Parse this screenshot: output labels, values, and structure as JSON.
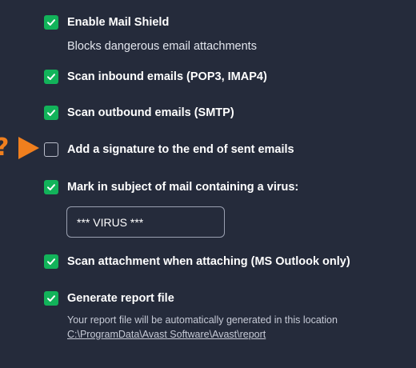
{
  "settings": {
    "enable_mail_shield": {
      "label": "Enable Mail Shield",
      "checked": true,
      "description": "Blocks dangerous email attachments"
    },
    "scan_inbound": {
      "label": "Scan inbound emails (POP3, IMAP4)",
      "checked": true
    },
    "scan_outbound": {
      "label": "Scan outbound emails (SMTP)",
      "checked": true
    },
    "add_signature": {
      "label": "Add a signature to the end of sent emails",
      "checked": false
    },
    "mark_subject": {
      "label": "Mark in subject of mail containing a virus:",
      "checked": true,
      "input_value": "*** VIRUS ***"
    },
    "scan_attachment": {
      "label": "Scan attachment when attaching (MS Outlook only)",
      "checked": true
    },
    "generate_report": {
      "label": "Generate report file",
      "checked": true,
      "description": "Your report file will be automatically generated in this location",
      "path": "C:\\ProgramData\\Avast Software\\Avast\\report"
    }
  },
  "annotation": {
    "glyph": "?",
    "color": "#f07f1e"
  },
  "colors": {
    "background": "#252b3b",
    "checkbox_checked": "#12b35a",
    "accent": "#f07f1e"
  },
  "icons": {
    "checked": "checkmark-icon",
    "pointer": "arrow-right-icon"
  }
}
